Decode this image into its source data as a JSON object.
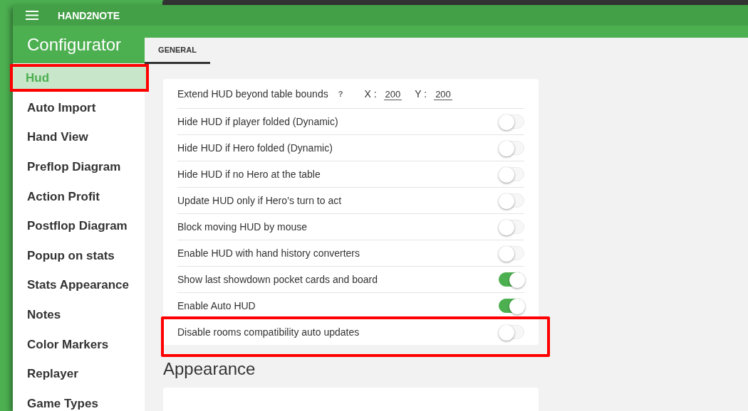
{
  "app": {
    "title": "HAND2NOTE"
  },
  "sidebar": {
    "title": "Configurator",
    "items": [
      {
        "label": "Hud",
        "selected": true,
        "highlighted": true
      },
      {
        "label": "Auto Import",
        "selected": false,
        "highlighted": false
      },
      {
        "label": "Hand View",
        "selected": false,
        "highlighted": false
      },
      {
        "label": "Preflop Diagram",
        "selected": false,
        "highlighted": false
      },
      {
        "label": "Action Profit",
        "selected": false,
        "highlighted": false
      },
      {
        "label": "Postflop Diagram",
        "selected": false,
        "highlighted": false
      },
      {
        "label": "Popup on stats",
        "selected": false,
        "highlighted": false
      },
      {
        "label": "Stats Appearance",
        "selected": false,
        "highlighted": false
      },
      {
        "label": "Notes",
        "selected": false,
        "highlighted": false
      },
      {
        "label": "Color Markers",
        "selected": false,
        "highlighted": false
      },
      {
        "label": "Replayer",
        "selected": false,
        "highlighted": false
      },
      {
        "label": "Game Types",
        "selected": false,
        "highlighted": false
      }
    ]
  },
  "tabs": [
    {
      "label": "GENERAL",
      "selected": true
    }
  ],
  "general": {
    "rows": [
      {
        "kind": "offset",
        "label": "Extend HUD beyond table bounds",
        "help": "?",
        "x_label": "X :",
        "x_value": "200",
        "y_label": "Y :",
        "y_value": "200",
        "highlighted": false
      },
      {
        "kind": "toggle",
        "label": "Hide HUD if player folded (Dynamic)",
        "on": false,
        "highlighted": false
      },
      {
        "kind": "toggle",
        "label": "Hide HUD if Hero folded (Dynamic)",
        "on": false,
        "highlighted": false
      },
      {
        "kind": "toggle",
        "label": "Hide HUD if no Hero at the table",
        "on": false,
        "highlighted": false
      },
      {
        "kind": "toggle",
        "label": "Update HUD only if Hero’s turn to act",
        "on": false,
        "highlighted": false
      },
      {
        "kind": "toggle",
        "label": "Block moving HUD by mouse",
        "on": false,
        "highlighted": false
      },
      {
        "kind": "toggle",
        "label": "Enable HUD with hand history converters",
        "on": false,
        "highlighted": false
      },
      {
        "kind": "toggle",
        "label": "Show last showdown pocket cards and board",
        "on": true,
        "highlighted": false
      },
      {
        "kind": "toggle",
        "label": "Enable Auto HUD",
        "on": true,
        "highlighted": false
      },
      {
        "kind": "toggle",
        "label": "Disable rooms compatibility auto updates",
        "on": false,
        "highlighted": true
      }
    ]
  },
  "sections": [
    {
      "title": "Appearance"
    }
  ]
}
